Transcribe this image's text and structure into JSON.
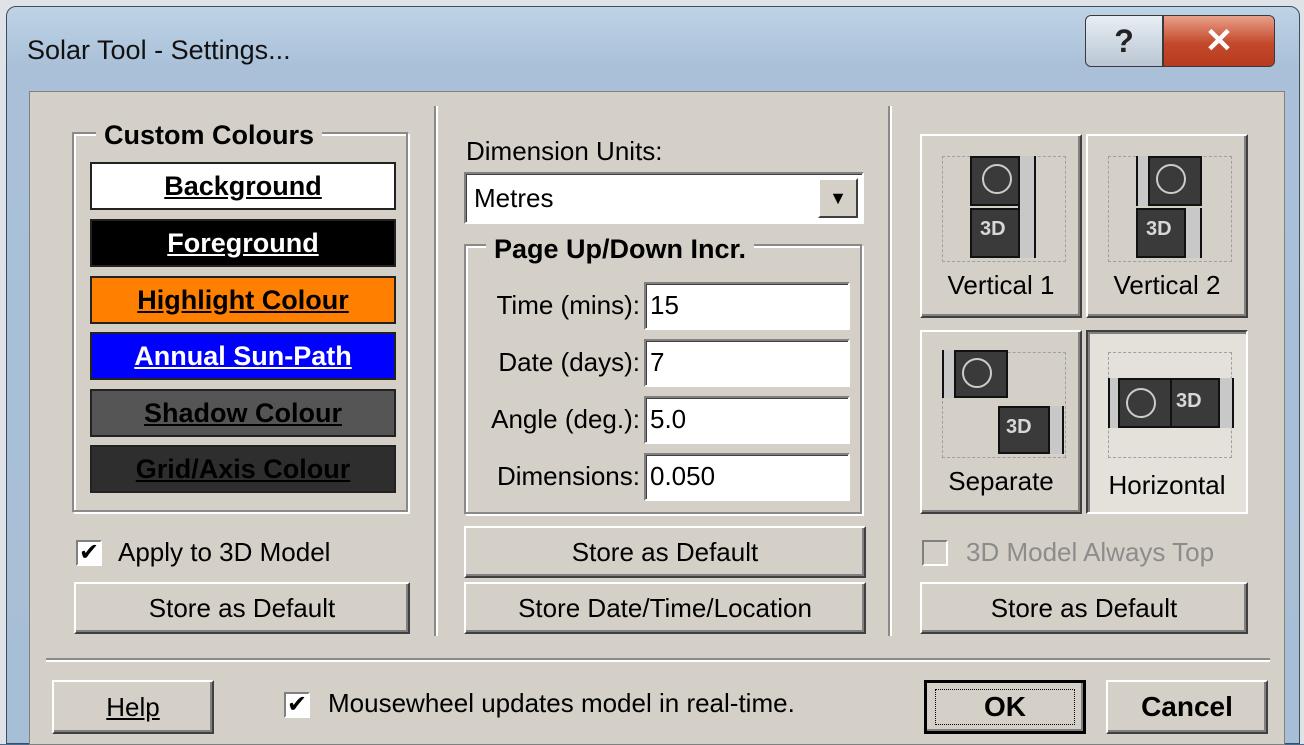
{
  "window": {
    "title": "Solar Tool - Settings...",
    "help_glyph": "?",
    "close_glyph": "✕"
  },
  "colours": {
    "group_label": "Custom Colours",
    "buttons": [
      {
        "label": "Background",
        "bg": "#ffffff",
        "fg": "#000000"
      },
      {
        "label": "Foreground",
        "bg": "#000000",
        "fg": "#ffffff"
      },
      {
        "label": "Highlight Colour",
        "bg": "#ff7f00",
        "fg": "#000000"
      },
      {
        "label": "Annual Sun-Path",
        "bg": "#0000ff",
        "fg": "#ffffff"
      },
      {
        "label": "Shadow Colour",
        "bg": "#555555",
        "fg": "#000000"
      },
      {
        "label": "Grid/Axis Colour",
        "bg": "#2e2e2e",
        "fg": "#000000"
      }
    ],
    "apply_3d_label": "Apply to 3D Model",
    "apply_3d_checked": true,
    "store_default": "Store as Default"
  },
  "units": {
    "label": "Dimension Units:",
    "value": "Metres",
    "increments": {
      "group_label": "Page Up/Down Incr.",
      "time_label": "Time (mins):",
      "time_value": "15",
      "date_label": "Date (days):",
      "date_value": "7",
      "angle_label": "Angle (deg.):",
      "angle_value": "5.0",
      "dimensions_label": "Dimensions:",
      "dimensions_value": "0.050"
    },
    "store_default": "Store as Default",
    "store_datetime": "Store Date/Time/Location"
  },
  "layout": {
    "vertical1": "Vertical 1",
    "vertical2": "Vertical 2",
    "separate": "Separate",
    "horizontal": "Horizontal",
    "icon_3d": "3D",
    "always_top_label": "3D Model Always Top",
    "always_top_checked": false,
    "store_default": "Store as Default"
  },
  "footer": {
    "help": "Help",
    "mousewheel_label": "Mousewheel updates model in real-time.",
    "mousewheel_checked": true,
    "ok": "OK",
    "cancel": "Cancel"
  }
}
